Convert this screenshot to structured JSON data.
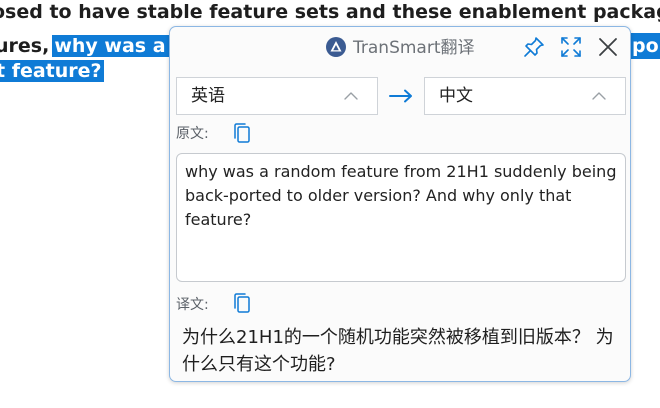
{
  "article": {
    "line1": "osed to have stable feature sets and these enablement packages wh",
    "line2_plain": "ures,",
    "line2_highlight": "why was a ra",
    "line2_right_highlight": "po",
    "line3_highlight": "t feature?"
  },
  "translator": {
    "app_title": "TranSmart翻译",
    "icons": {
      "logo": "transmart-logo-icon",
      "pin": "pin-icon",
      "expand": "expand-icon",
      "close": "close-icon",
      "swap": "arrow-right-icon",
      "chevron": "chevron-up-icon",
      "copy": "copy-icon"
    },
    "source_language": "英语",
    "target_language": "中文",
    "source_label": "原文:",
    "target_label": "译文:",
    "source_text": "why was a random feature from 21H1 suddenly being back-ported to older version? And why only that feature?",
    "target_text": "为什么21H1的一个随机功能突然被移植到旧版本？ 为什么只有这个功能?",
    "colors": {
      "accent": "#0f7bd6",
      "highlight": "#0f7bd6",
      "border": "#8cb7e4",
      "logo": "#3b5b92"
    }
  }
}
